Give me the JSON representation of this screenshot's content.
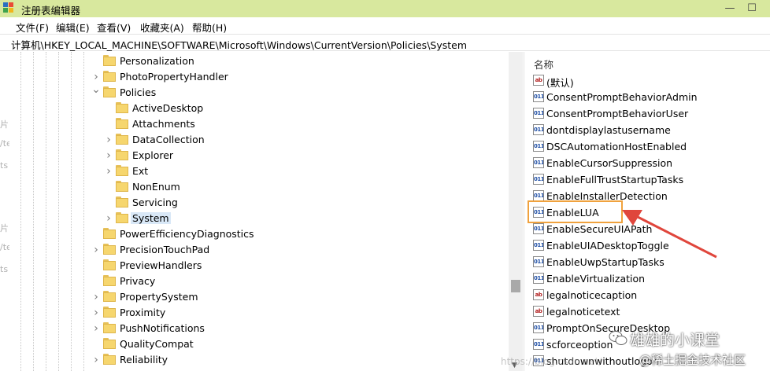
{
  "window": {
    "title": "注册表编辑器",
    "controls": {
      "minimize": "—",
      "maximize": "☐"
    }
  },
  "menu": [
    "文件(F)",
    "编辑(E)",
    "查看(V)",
    "收藏夹(A)",
    "帮助(H)"
  ],
  "address": "计算机\\HKEY_LOCAL_MACHINE\\SOFTWARE\\Microsoft\\Windows\\CurrentVersion\\Policies\\System",
  "behind_text": [
    "片",
    "/te",
    "ts",
    "片",
    "/te",
    "ts"
  ],
  "tree": [
    {
      "label": "Personalization",
      "level": 0,
      "expander": "none"
    },
    {
      "label": "PhotoPropertyHandler",
      "level": 0,
      "expander": "collapsed"
    },
    {
      "label": "Policies",
      "level": 0,
      "expander": "expanded"
    },
    {
      "label": "ActiveDesktop",
      "level": 1,
      "expander": "none"
    },
    {
      "label": "Attachments",
      "level": 1,
      "expander": "none"
    },
    {
      "label": "DataCollection",
      "level": 1,
      "expander": "collapsed"
    },
    {
      "label": "Explorer",
      "level": 1,
      "expander": "collapsed"
    },
    {
      "label": "Ext",
      "level": 1,
      "expander": "collapsed"
    },
    {
      "label": "NonEnum",
      "level": 1,
      "expander": "none"
    },
    {
      "label": "Servicing",
      "level": 1,
      "expander": "none"
    },
    {
      "label": "System",
      "level": 1,
      "expander": "collapsed",
      "selected": true
    },
    {
      "label": "PowerEfficiencyDiagnostics",
      "level": 0,
      "expander": "none"
    },
    {
      "label": "PrecisionTouchPad",
      "level": 0,
      "expander": "collapsed"
    },
    {
      "label": "PreviewHandlers",
      "level": 0,
      "expander": "none"
    },
    {
      "label": "Privacy",
      "level": 0,
      "expander": "none"
    },
    {
      "label": "PropertySystem",
      "level": 0,
      "expander": "collapsed"
    },
    {
      "label": "Proximity",
      "level": 0,
      "expander": "collapsed"
    },
    {
      "label": "PushNotifications",
      "level": 0,
      "expander": "collapsed"
    },
    {
      "label": "QualityCompat",
      "level": 0,
      "expander": "none"
    },
    {
      "label": "Reliability",
      "level": 0,
      "expander": "collapsed"
    }
  ],
  "values_header": "名称",
  "values": [
    {
      "name": "(默认)",
      "type": "string",
      "icon": "ab"
    },
    {
      "name": "ConsentPromptBehaviorAdmin",
      "type": "binary",
      "icon": "011"
    },
    {
      "name": "ConsentPromptBehaviorUser",
      "type": "binary",
      "icon": "011"
    },
    {
      "name": "dontdisplaylastusername",
      "type": "binary",
      "icon": "011"
    },
    {
      "name": "DSCAutomationHostEnabled",
      "type": "binary",
      "icon": "011"
    },
    {
      "name": "EnableCursorSuppression",
      "type": "binary",
      "icon": "011"
    },
    {
      "name": "EnableFullTrustStartupTasks",
      "type": "binary",
      "icon": "011"
    },
    {
      "name": "EnableInstallerDetection",
      "type": "binary",
      "icon": "011"
    },
    {
      "name": "EnableLUA",
      "type": "binary",
      "icon": "011",
      "highlighted": true
    },
    {
      "name": "EnableSecureUIAPath",
      "type": "binary",
      "icon": "011"
    },
    {
      "name": "EnableUIADesktopToggle",
      "type": "binary",
      "icon": "011"
    },
    {
      "name": "EnableUwpStartupTasks",
      "type": "binary",
      "icon": "011"
    },
    {
      "name": "EnableVirtualization",
      "type": "binary",
      "icon": "011"
    },
    {
      "name": "legalnoticecaption",
      "type": "string",
      "icon": "ab"
    },
    {
      "name": "legalnoticetext",
      "type": "string",
      "icon": "ab"
    },
    {
      "name": "PromptOnSecureDesktop",
      "type": "binary",
      "icon": "011"
    },
    {
      "name": "scforceoption",
      "type": "binary",
      "icon": "011"
    },
    {
      "name": "shutdownwithoutlogon",
      "type": "binary",
      "icon": "011"
    }
  ],
  "watermarks": {
    "wechat": "雄雄的小课堂",
    "juejin": "@稀土掘金技术社区",
    "url": "https://blog.csdn.net/"
  },
  "colors": {
    "titlebar": "#d8e89e",
    "highlight_box": "#f0a23e",
    "arrow": "#e0463c",
    "selection": "#d9e8f7"
  }
}
